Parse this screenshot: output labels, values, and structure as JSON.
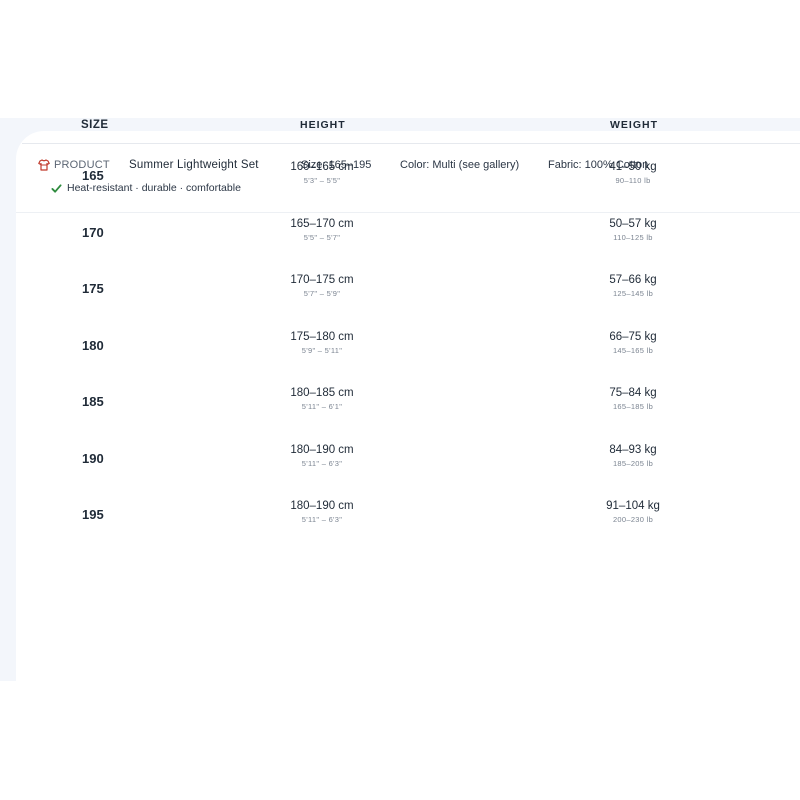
{
  "product": {
    "tag_label": "PRODUCT",
    "name": "Summer Lightweight Set",
    "size_range": "Size: 165–195",
    "color": "Color: Multi (see gallery)",
    "fabric": "Fabric: 100% Cotton",
    "features": "Heat-resistant · durable · comfortable",
    "tag_icon": "shirt-icon",
    "feature_icon": "check-icon",
    "accent_color": "#c0392b",
    "check_color": "#2e8b3e"
  },
  "table": {
    "headers": {
      "size": "SIZE",
      "height": "HEIGHT",
      "weight": "WEIGHT"
    },
    "rows": [
      {
        "size": "165",
        "height_cm": "160–165 cm",
        "height_ft": "5'3\" – 5'5\"",
        "weight_kg": "41–50 kg",
        "weight_lb": "90–110 lb"
      },
      {
        "size": "170",
        "height_cm": "165–170 cm",
        "height_ft": "5'5\" – 5'7\"",
        "weight_kg": "50–57 kg",
        "weight_lb": "110–125 lb"
      },
      {
        "size": "175",
        "height_cm": "170–175 cm",
        "height_ft": "5'7\" – 5'9\"",
        "weight_kg": "57–66 kg",
        "weight_lb": "125–145 lb"
      },
      {
        "size": "180",
        "height_cm": "175–180 cm",
        "height_ft": "5'9\" – 5'11\"",
        "weight_kg": "66–75 kg",
        "weight_lb": "145–165 lb"
      },
      {
        "size": "185",
        "height_cm": "180–185 cm",
        "height_ft": "5'11\" – 6'1\"",
        "weight_kg": "75–84 kg",
        "weight_lb": "165–185 lb"
      },
      {
        "size": "190",
        "height_cm": "180–190 cm",
        "height_ft": "5'11\" – 6'3\"",
        "weight_kg": "84–93 kg",
        "weight_lb": "185–205 lb"
      },
      {
        "size": "195",
        "height_cm": "180–190 cm",
        "height_ft": "5'11\" – 6'3\"",
        "weight_kg": "91–104 kg",
        "weight_lb": "200–230 lb"
      }
    ]
  }
}
